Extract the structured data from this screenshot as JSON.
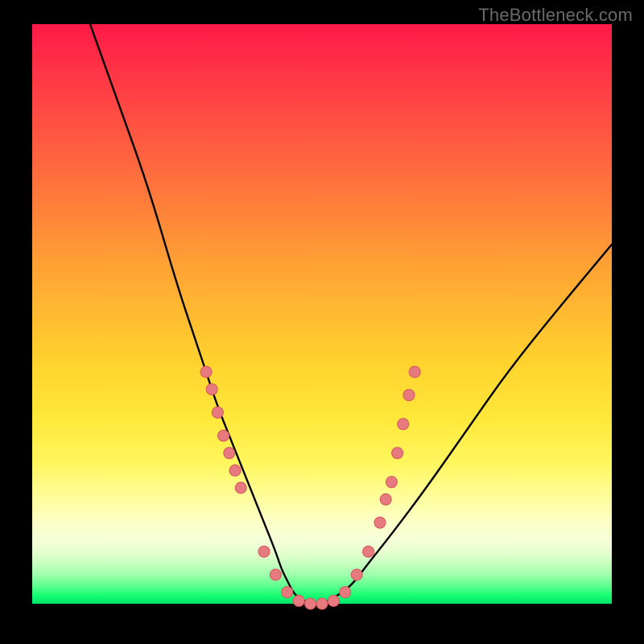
{
  "watermark": "TheBottleneck.com",
  "chart_data": {
    "type": "line",
    "title": "",
    "xlabel": "",
    "ylabel": "",
    "xlim": [
      0,
      100
    ],
    "ylim": [
      0,
      100
    ],
    "grid": false,
    "legend": false,
    "background_gradient": {
      "direction": "vertical",
      "stops": [
        {
          "pos": 0,
          "meaning": "worst",
          "color": "#ff1a47"
        },
        {
          "pos": 50,
          "meaning": "mid",
          "color": "#ffd22e"
        },
        {
          "pos": 100,
          "meaning": "best",
          "color": "#00e46a"
        }
      ]
    },
    "series": [
      {
        "name": "bottleneck-curve",
        "kind": "curve",
        "x": [
          10,
          15,
          20,
          25,
          28,
          30,
          32,
          34,
          36,
          38,
          40,
          42,
          43,
          44,
          45,
          46,
          48,
          50,
          52,
          55,
          58,
          62,
          68,
          75,
          82,
          90,
          100
        ],
        "y": [
          100,
          86,
          72,
          55,
          46,
          40,
          34,
          29,
          24,
          19,
          14,
          9,
          6,
          4,
          2,
          1,
          0,
          0,
          1,
          3,
          7,
          12,
          20,
          30,
          40,
          50,
          62
        ]
      },
      {
        "name": "marker-dots",
        "kind": "scatter",
        "points": [
          {
            "x": 30,
            "y": 40
          },
          {
            "x": 31,
            "y": 37
          },
          {
            "x": 32,
            "y": 33
          },
          {
            "x": 33,
            "y": 29
          },
          {
            "x": 34,
            "y": 26
          },
          {
            "x": 35,
            "y": 23
          },
          {
            "x": 36,
            "y": 20
          },
          {
            "x": 40,
            "y": 9
          },
          {
            "x": 42,
            "y": 5
          },
          {
            "x": 44,
            "y": 2
          },
          {
            "x": 46,
            "y": 0.5
          },
          {
            "x": 48,
            "y": 0
          },
          {
            "x": 50,
            "y": 0
          },
          {
            "x": 52,
            "y": 0.5
          },
          {
            "x": 54,
            "y": 2
          },
          {
            "x": 56,
            "y": 5
          },
          {
            "x": 58,
            "y": 9
          },
          {
            "x": 60,
            "y": 14
          },
          {
            "x": 61,
            "y": 18
          },
          {
            "x": 62,
            "y": 21
          },
          {
            "x": 63,
            "y": 26
          },
          {
            "x": 64,
            "y": 31
          },
          {
            "x": 65,
            "y": 36
          },
          {
            "x": 66,
            "y": 40
          }
        ]
      }
    ],
    "annotations": []
  },
  "colors": {
    "dot_fill": "#e77a7f",
    "dot_stroke": "#d6555d",
    "curve": "#000000",
    "frame": "#000000"
  }
}
